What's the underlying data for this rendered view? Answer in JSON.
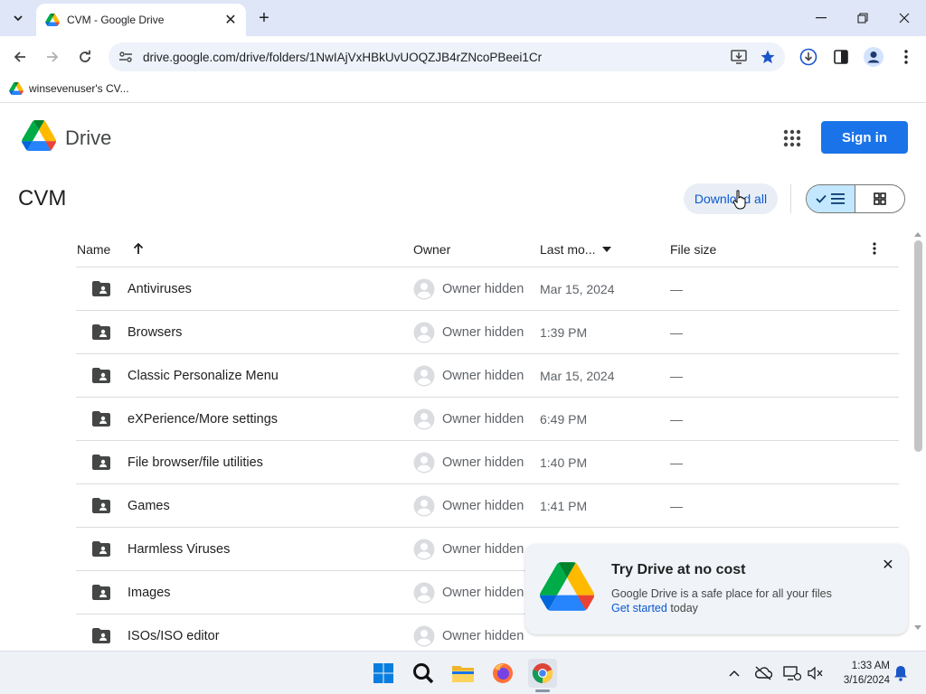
{
  "browser": {
    "tab_title": "CVM - Google Drive",
    "url": "drive.google.com/drive/folders/1NwIAjVxHBkUvUOQZJB4rZNcoPBeei1Cr",
    "bookmark_label": "winsevenuser's CV..."
  },
  "drive": {
    "app_name": "Drive",
    "signin_label": "Sign in"
  },
  "folder": {
    "title": "CVM",
    "download_all_label": "Download all"
  },
  "table": {
    "columns": {
      "name": "Name",
      "owner": "Owner",
      "last_modified": "Last mo...",
      "file_size": "File size"
    },
    "rows": [
      {
        "name": "Antiviruses",
        "owner": "Owner hidden",
        "modified": "Mar 15, 2024",
        "size": "—"
      },
      {
        "name": "Browsers",
        "owner": "Owner hidden",
        "modified": "1:39 PM",
        "size": "—"
      },
      {
        "name": "Classic Personalize Menu",
        "owner": "Owner hidden",
        "modified": "Mar 15, 2024",
        "size": "—"
      },
      {
        "name": "eXPerience/More settings",
        "owner": "Owner hidden",
        "modified": "6:49 PM",
        "size": "—"
      },
      {
        "name": "File browser/file utilities",
        "owner": "Owner hidden",
        "modified": "1:40 PM",
        "size": "—"
      },
      {
        "name": "Games",
        "owner": "Owner hidden",
        "modified": "1:41 PM",
        "size": "—"
      },
      {
        "name": "Harmless Viruses",
        "owner": "Owner hidden",
        "modified": "",
        "size": ""
      },
      {
        "name": "Images",
        "owner": "Owner hidden",
        "modified": "",
        "size": ""
      },
      {
        "name": "ISOs/ISO editor",
        "owner": "Owner hidden",
        "modified": "",
        "size": ""
      }
    ]
  },
  "promo": {
    "title": "Try Drive at no cost",
    "body": "Google Drive is a safe place for all your files",
    "link": "Get started",
    "suffix": " today"
  },
  "taskbar": {
    "time": "1:33 AM",
    "date": "3/16/2024"
  },
  "colors": {
    "accent": "#1a73e8",
    "tabstrip": "#dee6f7",
    "selected_toggle": "#c2e7ff"
  }
}
